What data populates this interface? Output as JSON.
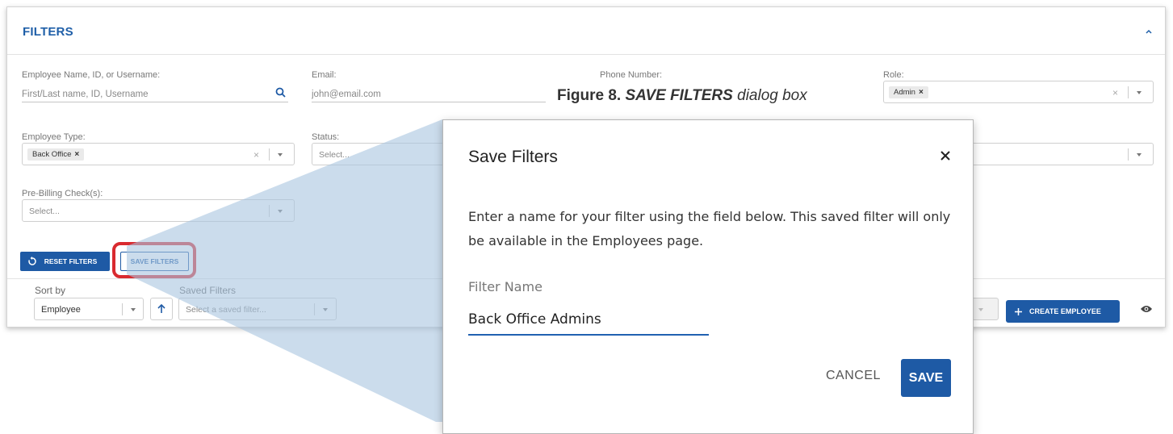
{
  "panel": {
    "title": "FILTERS",
    "fields": {
      "employee_search": {
        "label": "Employee Name, ID, or Username:",
        "placeholder": "First/Last name, ID, Username"
      },
      "email": {
        "label": "Email:",
        "placeholder": "john@email.com"
      },
      "phone": {
        "label": "Phone Number:"
      },
      "role": {
        "label": "Role:",
        "chip": "Admin"
      },
      "employee_type": {
        "label": "Employee Type:",
        "chip": "Back Office"
      },
      "status": {
        "label": "Status:",
        "placeholder": "Select..."
      },
      "pre_billing": {
        "label": "Pre-Billing Check(s):",
        "placeholder": "Select..."
      }
    },
    "buttons": {
      "reset_filters": "RESET FILTERS",
      "save_filters": "SAVE FILTERS"
    },
    "sort": {
      "label": "Sort by",
      "value": "Employee"
    },
    "saved_filters": {
      "label": "Saved Filters",
      "placeholder": "Select a saved filter..."
    },
    "create_employee": "CREATE EMPLOYEE"
  },
  "caption": {
    "figure": "Figure 8.",
    "title": "SAVE FILTERS",
    "description": "dialog box"
  },
  "dialog": {
    "title": "Save Filters",
    "message": "Enter a name for your filter using the field below. This saved filter will only be available in the Employees page.",
    "field_label": "Filter Name",
    "field_value": "Back Office Admins",
    "cancel": "CANCEL",
    "save": "SAVE"
  },
  "colors": {
    "accent": "#1e5aa5",
    "highlight": "#d92a2f",
    "projection": "#a8c4e0"
  },
  "icons": [
    "chevron-up-icon",
    "search-icon",
    "close-icon",
    "dropdown-arrow-icon",
    "reset-icon",
    "arrow-up-icon",
    "plus-icon",
    "eye-icon"
  ]
}
